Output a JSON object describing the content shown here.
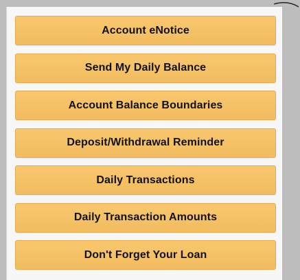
{
  "notice_options": {
    "items": [
      {
        "label": "Account eNotice"
      },
      {
        "label": "Send My Daily Balance"
      },
      {
        "label": "Account Balance Boundaries"
      },
      {
        "label": "Deposit/Withdrawal Reminder"
      },
      {
        "label": "Daily Transactions"
      },
      {
        "label": "Daily Transaction Amounts"
      },
      {
        "label": "Don't Forget Your Loan"
      }
    ]
  },
  "colors": {
    "button_fill": "#f5c166",
    "button_border": "#e2ad52",
    "panel_background": "#f7f7f7",
    "page_background": "#bdbdbd"
  }
}
